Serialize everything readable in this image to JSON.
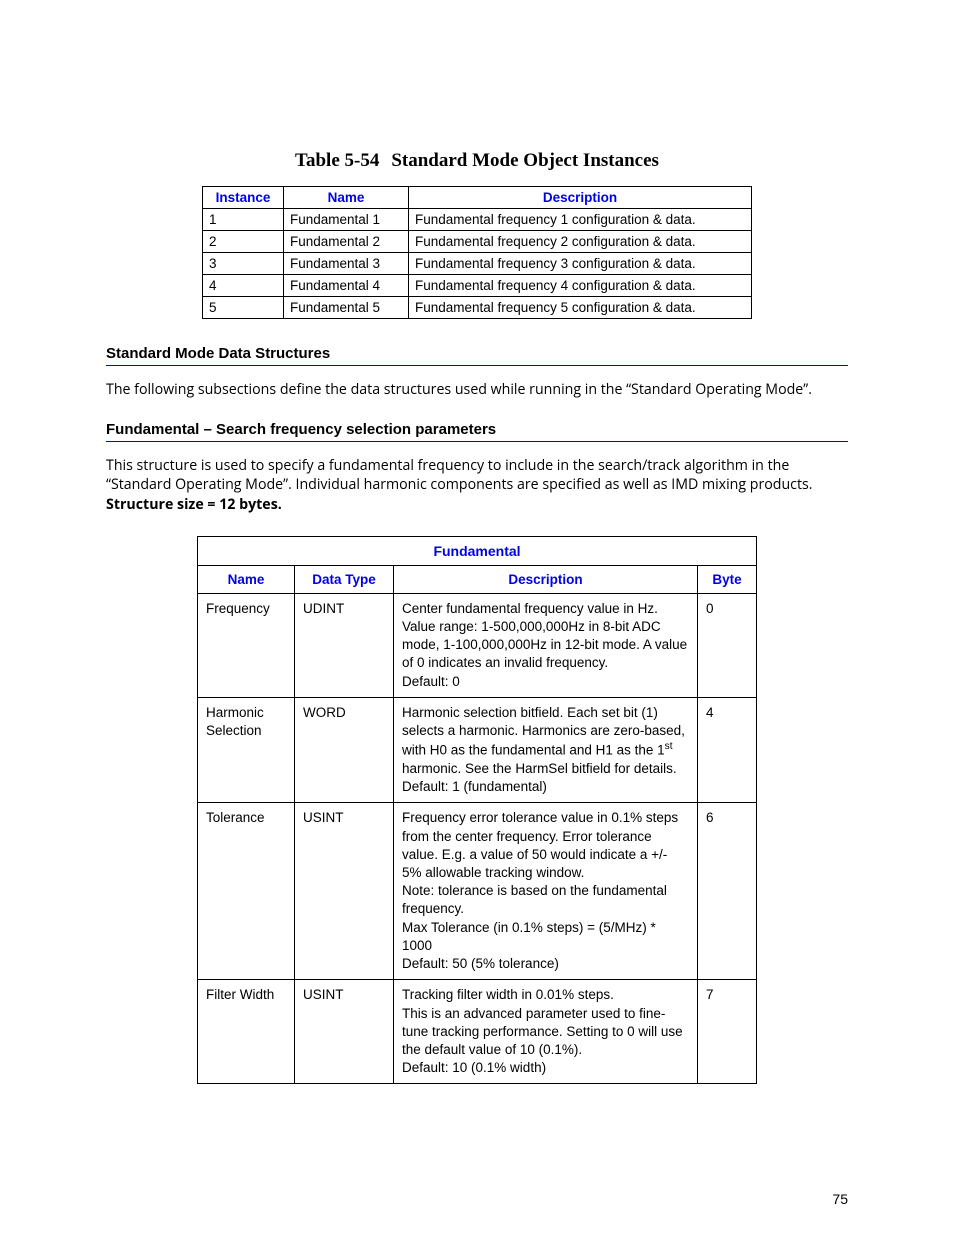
{
  "page_number": "75",
  "table1": {
    "caption_prefix": "Table 5-54",
    "caption_title": "Standard Mode Object Instances",
    "headers": {
      "instance": "Instance",
      "name": "Name",
      "description": "Description"
    },
    "rows": [
      {
        "instance": "1",
        "name": "Fundamental 1",
        "description": "Fundamental frequency 1 configuration & data."
      },
      {
        "instance": "2",
        "name": "Fundamental 2",
        "description": "Fundamental frequency 2 configuration & data."
      },
      {
        "instance": "3",
        "name": "Fundamental 3",
        "description": "Fundamental frequency 3 configuration & data."
      },
      {
        "instance": "4",
        "name": "Fundamental 4",
        "description": "Fundamental frequency 4 configuration & data."
      },
      {
        "instance": "5",
        "name": "Fundamental 5",
        "description": "Fundamental frequency 5 configuration & data."
      }
    ]
  },
  "section1": {
    "title": "Standard Mode Data Structures",
    "text": "The following subsections define the data structures used while running in the “Standard Operating Mode”."
  },
  "section2": {
    "title": "Fundamental – Search frequency selection parameters",
    "text_plain": "This structure is used to specify a fundamental frequency to include in the search/track algorithm in the “Standard Operating Mode”. Individual harmonic components are specified as well as IMD mixing products. ",
    "text_bold": "Structure size = 12 bytes."
  },
  "table2": {
    "title": "Fundamental",
    "headers": {
      "name": "Name",
      "type": "Data Type",
      "description": "Description",
      "byte": "Byte"
    },
    "rows": [
      {
        "name": "Frequency",
        "type": "UDINT",
        "description": "Center fundamental frequency value in Hz.\nValue range: 1-500,000,000Hz in 8-bit ADC mode, 1-100,000,000Hz in 12-bit mode. A value of 0 indicates an invalid frequency.\nDefault: 0",
        "byte": "0"
      },
      {
        "name": "Harmonic Selection",
        "type": "WORD",
        "desc_pre": "Harmonic selection bitfield. Each set bit (1) selects a harmonic. Harmonics are zero-based, with H0 as the fundamental and H1 as the 1",
        "desc_sup": "st",
        "desc_post": " harmonic. See the HarmSel bitfield for details.\nDefault: 1 (fundamental)",
        "byte": "4"
      },
      {
        "name": "Tolerance",
        "type": "USINT",
        "description": "Frequency error tolerance value in 0.1% steps from the center frequency. Error tolerance value. E.g. a value of 50 would indicate a +/- 5% allowable tracking window.\nNote: tolerance is based on the fundamental frequency.\nMax Tolerance (in 0.1% steps) = (5/MHz) * 1000\nDefault: 50 (5% tolerance)",
        "byte": "6"
      },
      {
        "name": "Filter Width",
        "type": "USINT",
        "description": "Tracking filter width in 0.01% steps.\nThis is an advanced parameter used to fine-tune tracking performance. Setting to 0 will use the default value of 10 (0.1%).\nDefault: 10 (0.1% width)",
        "byte": "7"
      }
    ]
  }
}
